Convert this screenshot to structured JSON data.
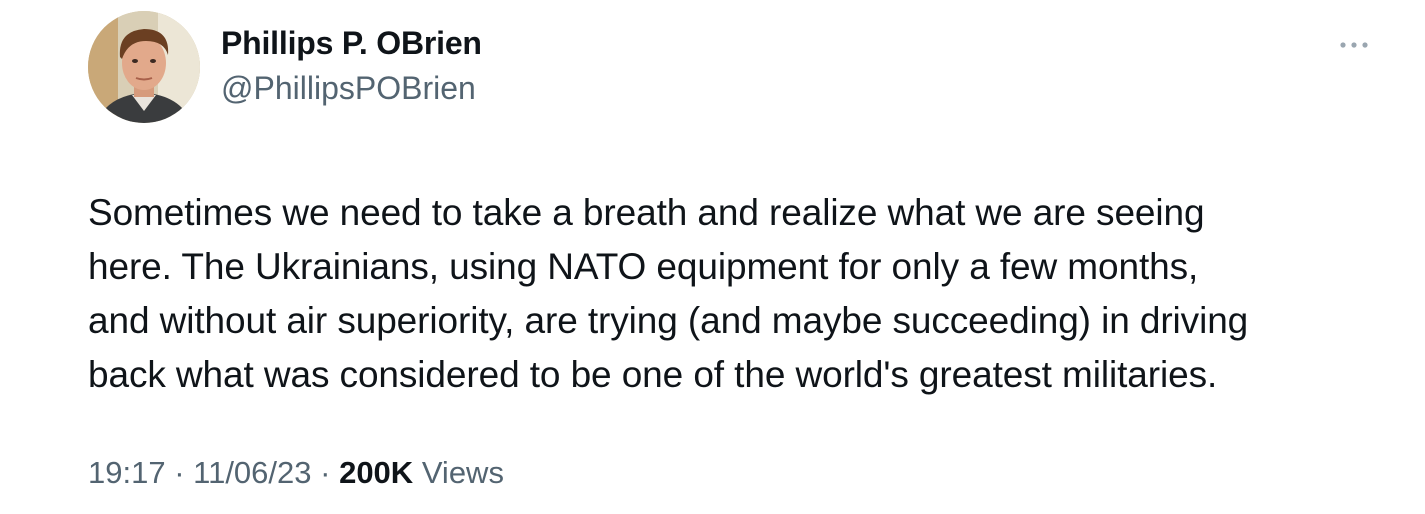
{
  "author": {
    "display_name": "Phillips P. OBrien",
    "handle": "@PhillipsPOBrien",
    "avatar_icon": "profile-photo"
  },
  "more_icon": "more-horizontal-icon",
  "tweet": {
    "lines": [
      "Sometimes we need to take a breath and realize what we are seeing",
      "here. The Ukrainians, using NATO equipment for only a few months,",
      "and without air superiority, are trying (and maybe succeeding) in driving",
      "back what was considered to be one of the world's greatest militaries."
    ]
  },
  "meta": {
    "time": "19:17",
    "separator": " · ",
    "date": "11/06/23",
    "views_count": "200K",
    "views_label": "Views"
  },
  "colors": {
    "text_primary": "#0f1419",
    "text_secondary": "#536471",
    "background": "#ffffff"
  }
}
